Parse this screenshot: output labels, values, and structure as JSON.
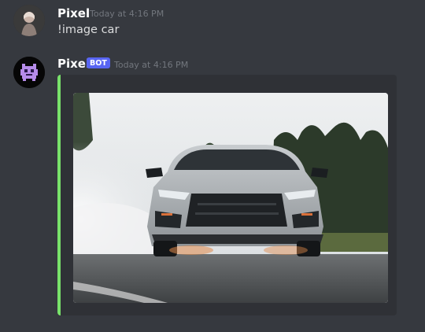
{
  "messages": [
    {
      "author": "Pixel",
      "timestamp": "Today at 4:16 PM",
      "content": "!image car"
    },
    {
      "author": "Pixel",
      "badge": "BOT",
      "timestamp": "Today at 4:16 PM",
      "embed": {
        "accent_color": "#78e26a",
        "image": "photo of a silver sports car drifting with tire smoke on a road"
      }
    }
  ],
  "colors": {
    "background": "#36393f",
    "bot_badge": "#5865f2",
    "embed_background": "#2f3136"
  }
}
